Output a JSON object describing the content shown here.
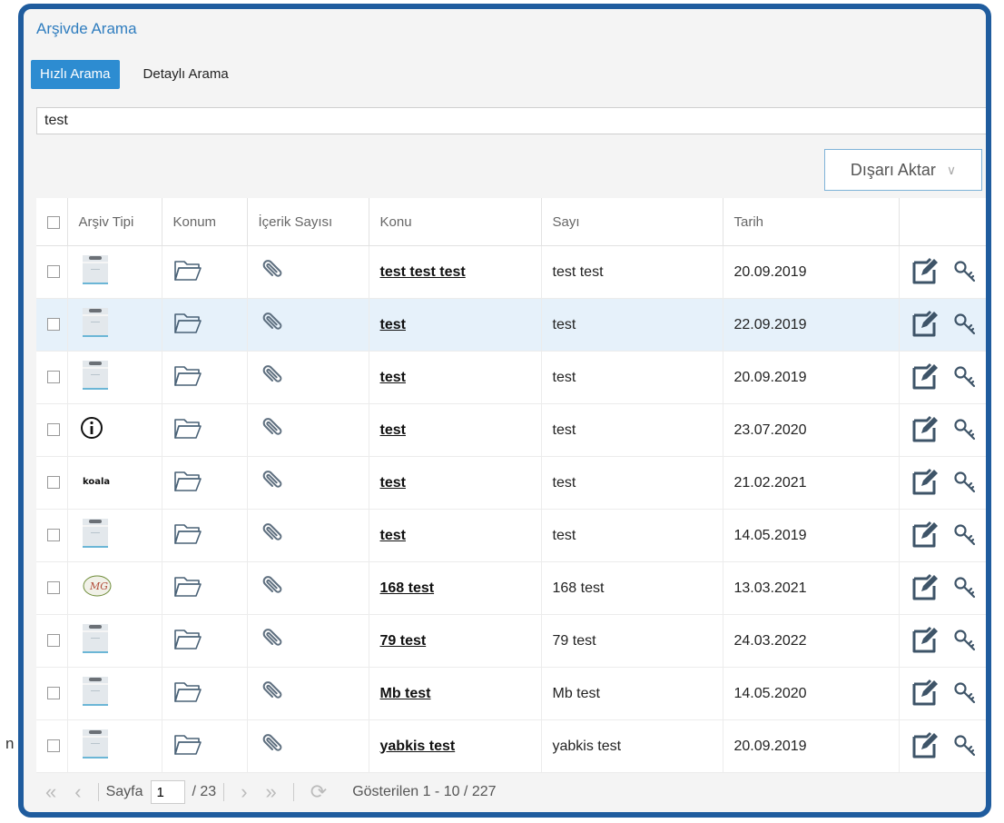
{
  "page": {
    "title": "Arşivde Arama",
    "stray_char": "n"
  },
  "tabs": [
    {
      "label": "Hızlı Arama",
      "active": true
    },
    {
      "label": "Detaylı Arama",
      "active": false
    }
  ],
  "search": {
    "value": "test"
  },
  "toolbar": {
    "export_label": "Dışarı Aktar",
    "export_chevron": "∨"
  },
  "table": {
    "columns": [
      "",
      "Arşiv Tipi",
      "Konum",
      "İçerik Sayısı",
      "Konu",
      "Sayı",
      "Tarih",
      ""
    ],
    "rows": [
      {
        "icon": "archive-box",
        "konu": "test test test",
        "sayi": "test test",
        "tarih": "20.09.2019",
        "selected": false
      },
      {
        "icon": "archive-box",
        "konu": "test",
        "sayi": "test",
        "tarih": "22.09.2019",
        "selected": true
      },
      {
        "icon": "archive-box",
        "konu": "test",
        "sayi": "test",
        "tarih": "20.09.2019",
        "selected": false
      },
      {
        "icon": "info-circle",
        "konu": "test",
        "sayi": "test",
        "tarih": "23.07.2020",
        "selected": false
      },
      {
        "icon": "koala-logo",
        "konu": "test",
        "sayi": "test",
        "tarih": "21.02.2021",
        "selected": false
      },
      {
        "icon": "archive-box",
        "konu": "test",
        "sayi": "test",
        "tarih": "14.05.2019",
        "selected": false
      },
      {
        "icon": "mg-logo",
        "konu": "168 test",
        "sayi": "168 test",
        "tarih": "13.03.2021",
        "selected": false
      },
      {
        "icon": "archive-box",
        "konu": "79 test",
        "sayi": "79 test",
        "tarih": "24.03.2022",
        "selected": false
      },
      {
        "icon": "archive-box",
        "konu": "Mb test",
        "sayi": "Mb test",
        "tarih": "14.05.2020",
        "selected": false
      },
      {
        "icon": "archive-box",
        "konu": "yabkis test",
        "sayi": "yabkis test",
        "tarih": "20.09.2019",
        "selected": false
      }
    ]
  },
  "pager": {
    "label": "Sayfa",
    "current": "1",
    "total": "/ 23",
    "summary": "Gösterilen 1 - 10 / 227",
    "first_icon": "«",
    "prev_icon": "‹",
    "next_icon": "›",
    "last_icon": "»",
    "refresh_icon": "⟳"
  },
  "icons": {
    "koala_text": "koala",
    "mg_text": "MG"
  },
  "colors": {
    "accent": "#2d8cd1",
    "frame": "#1f5c9e",
    "selected_row": "#e6f1fa"
  }
}
